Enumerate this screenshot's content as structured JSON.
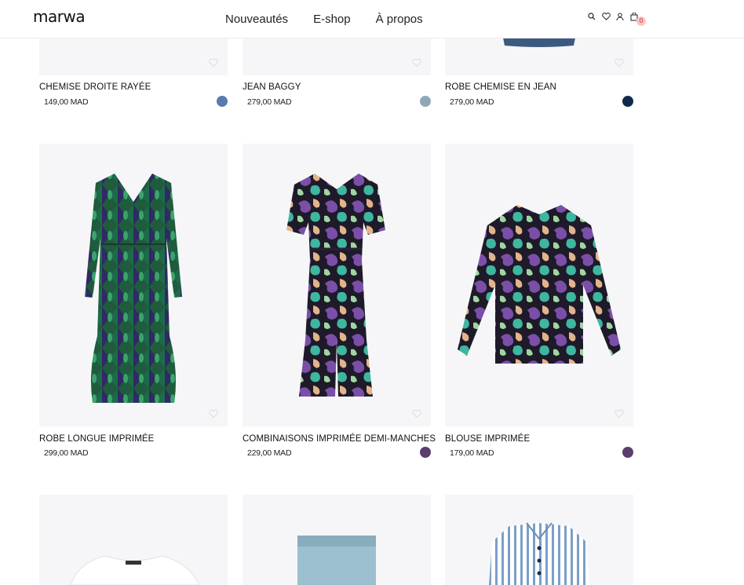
{
  "header": {
    "logo": "marwa",
    "nav": [
      "Nouveautés",
      "E-shop",
      "À propos"
    ],
    "icons": [
      "search-icon",
      "heart-icon",
      "user-icon",
      "bag-icon"
    ],
    "cart_count": "0"
  },
  "products": [
    {
      "name": "CHEMISE DROITE RAYÉE",
      "price": "149,00 MAD",
      "color": "#5a7bb0"
    },
    {
      "name": "JEAN BAGGY",
      "price": "279,00 MAD",
      "color": "#8fa8b8"
    },
    {
      "name": "ROBE CHEMISE EN JEAN",
      "price": "279,00 MAD",
      "color": "#0f2a4a"
    },
    {
      "name": "ROBE LONGUE IMPRIMÉE",
      "price": "299,00 MAD",
      "color": ""
    },
    {
      "name": "COMBINAISONS IMPRIMÉE DEMI-MANCHES",
      "price": "229,00 MAD",
      "color": "#5b3e6e"
    },
    {
      "name": "BLOUSE IMPRIMÉE",
      "price": "179,00 MAD",
      "color": "#5b3e6e"
    }
  ]
}
